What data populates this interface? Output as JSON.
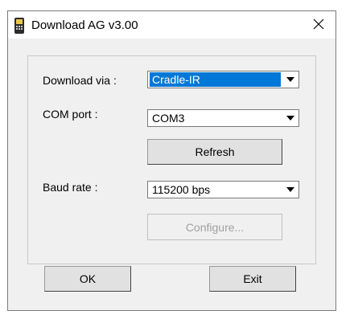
{
  "window": {
    "title": "Download AG  v3.00",
    "icon": "handheld-device-icon",
    "close_icon": "close-icon"
  },
  "form": {
    "download_via": {
      "label": "Download via :",
      "value": "Cradle-IR"
    },
    "com_port": {
      "label": "COM port :",
      "value": "COM3"
    },
    "refresh_label": "Refresh",
    "baud_rate": {
      "label": "Baud rate :",
      "value": "115200 bps"
    },
    "configure_label": "Configure..."
  },
  "footer": {
    "ok_label": "OK",
    "exit_label": "Exit"
  },
  "colors": {
    "selection": "#0078d7",
    "dialog_bg": "#f0f0f0",
    "disabled_text": "#a0a0a0"
  }
}
